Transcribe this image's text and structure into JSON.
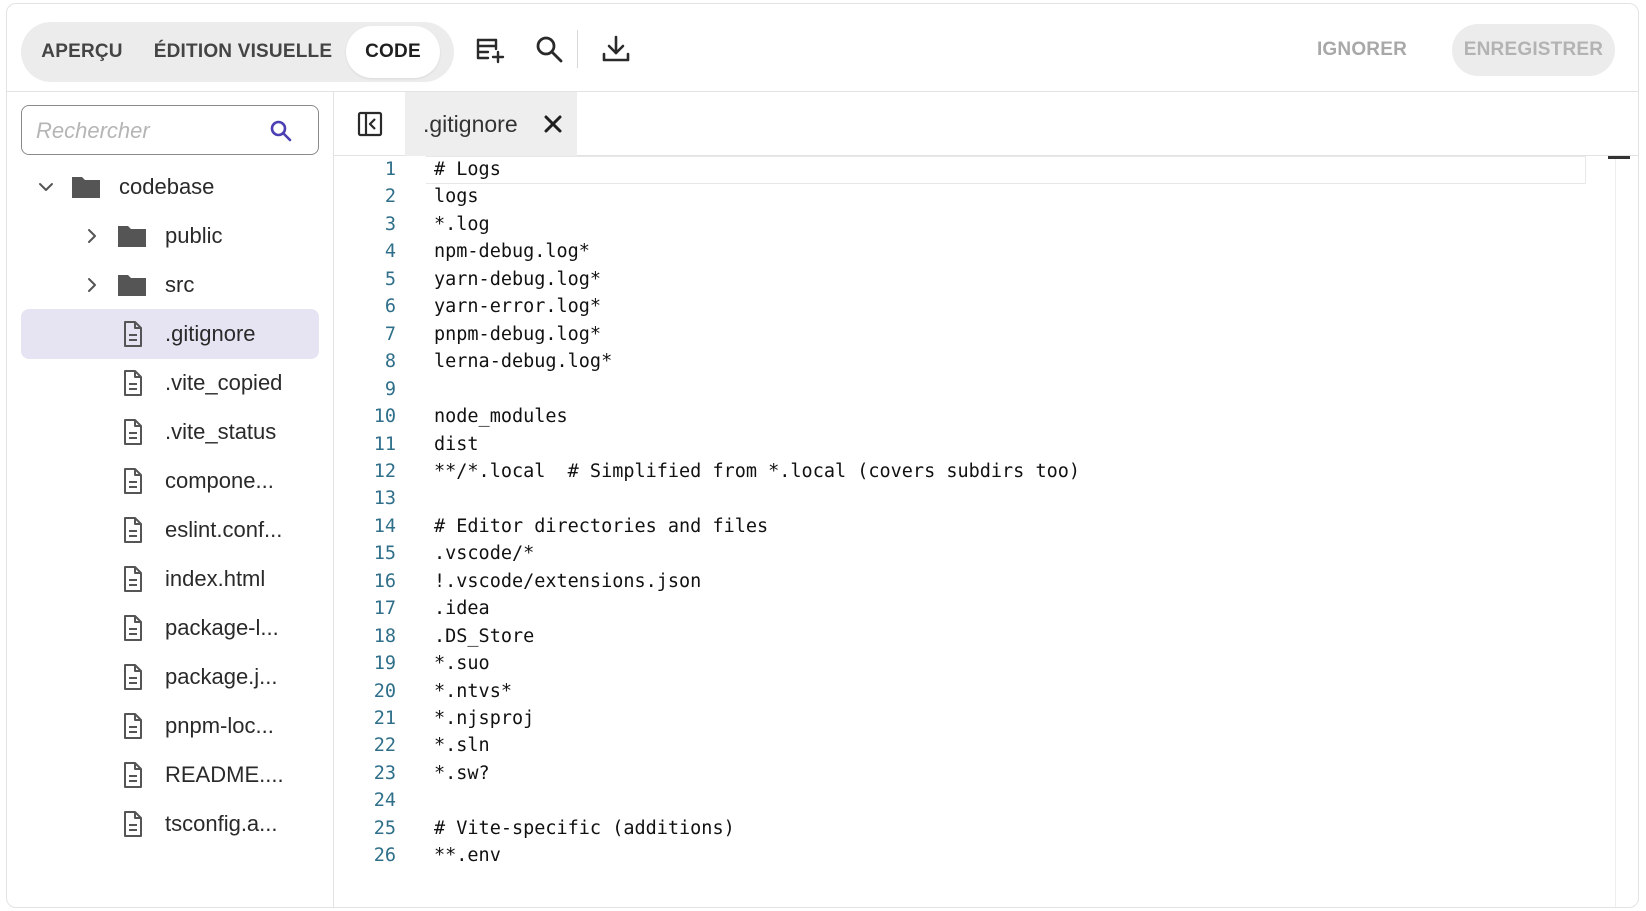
{
  "toolbar": {
    "tabs": [
      {
        "label": "APERÇU",
        "active": false
      },
      {
        "label": "ÉDITION VISUELLE",
        "active": false
      },
      {
        "label": "CODE",
        "active": true
      }
    ],
    "icons": [
      "new-file-icon",
      "search-icon",
      "download-icon"
    ],
    "ignore_label": "IGNORER",
    "save_label": "ENREGISTRER"
  },
  "sidebar": {
    "search_placeholder": "Rechercher",
    "tree": [
      {
        "label": "codebase",
        "type": "folder",
        "depth": 0,
        "expanded": true
      },
      {
        "label": "public",
        "type": "folder",
        "depth": 1,
        "expanded": false
      },
      {
        "label": "src",
        "type": "folder",
        "depth": 1,
        "expanded": false
      },
      {
        "label": ".gitignore",
        "type": "file",
        "depth": 1,
        "selected": true
      },
      {
        "label": ".vite_copied",
        "type": "file",
        "depth": 1
      },
      {
        "label": ".vite_status",
        "type": "file",
        "depth": 1
      },
      {
        "label": "compone...",
        "type": "file",
        "depth": 1
      },
      {
        "label": "eslint.conf...",
        "type": "file",
        "depth": 1
      },
      {
        "label": "index.html",
        "type": "file",
        "depth": 1
      },
      {
        "label": "package-l...",
        "type": "file",
        "depth": 1
      },
      {
        "label": "package.j...",
        "type": "file",
        "depth": 1
      },
      {
        "label": "pnpm-loc...",
        "type": "file",
        "depth": 1
      },
      {
        "label": "README....",
        "type": "file",
        "depth": 1
      },
      {
        "label": "tsconfig.a...",
        "type": "file",
        "depth": 1
      }
    ]
  },
  "editor": {
    "open_tab": ".gitignore",
    "current_line": 1,
    "lines": [
      "# Logs",
      "logs",
      "*.log",
      "npm-debug.log*",
      "yarn-debug.log*",
      "yarn-error.log*",
      "pnpm-debug.log*",
      "lerna-debug.log*",
      "",
      "node_modules",
      "dist",
      "**/*.local  # Simplified from *.local (covers subdirs too)",
      "",
      "# Editor directories and files",
      ".vscode/*",
      "!.vscode/extensions.json",
      ".idea",
      ".DS_Store",
      "*.suo",
      "*.ntvs*",
      "*.njsproj",
      "*.sln",
      "*.sw?",
      "",
      "# Vite-specific (additions)",
      "**.env"
    ]
  },
  "colors": {
    "selected_row": "#e6e4f3",
    "search_accent": "#4b3fb3",
    "line_number": "#2f6f8a"
  }
}
